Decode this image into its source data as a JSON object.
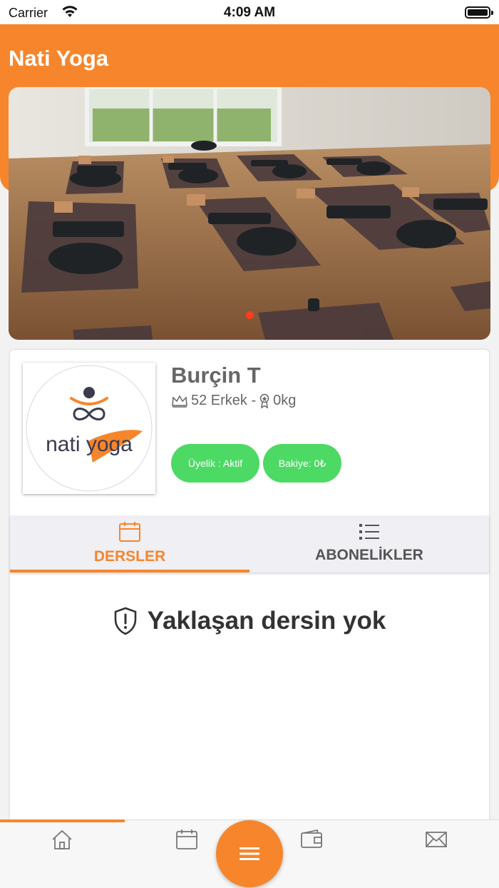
{
  "status_bar": {
    "carrier": "Carrier",
    "time": "4:09 AM"
  },
  "header": {
    "title": "Nati Yoga"
  },
  "slider": {
    "image": "yoga-studio-photo",
    "active_index": 0,
    "pages": 1
  },
  "profile": {
    "logo_text": "nati yoga",
    "name": "Burçin T",
    "meta": "52 Erkek -",
    "weight": "0kg",
    "membership": "Üyelik : Aktif",
    "balance": "Bakiye: 0₺"
  },
  "tabs": [
    {
      "label": "DERSLER",
      "icon": "calendar-icon",
      "active": true
    },
    {
      "label": "ABONELİKLER",
      "icon": "list-icon",
      "active": false
    }
  ],
  "empty_state": {
    "text": "Yaklaşan dersin yok",
    "icon": "shield-alert-icon"
  },
  "bottom_nav": {
    "items": [
      "home-icon",
      "calendar-icon",
      "wallet-icon",
      "mail-icon"
    ],
    "fab_icon": "menu-icon"
  },
  "colors": {
    "accent": "#f7852b",
    "success": "#4cd964",
    "indicator": "#ff3b1f"
  }
}
